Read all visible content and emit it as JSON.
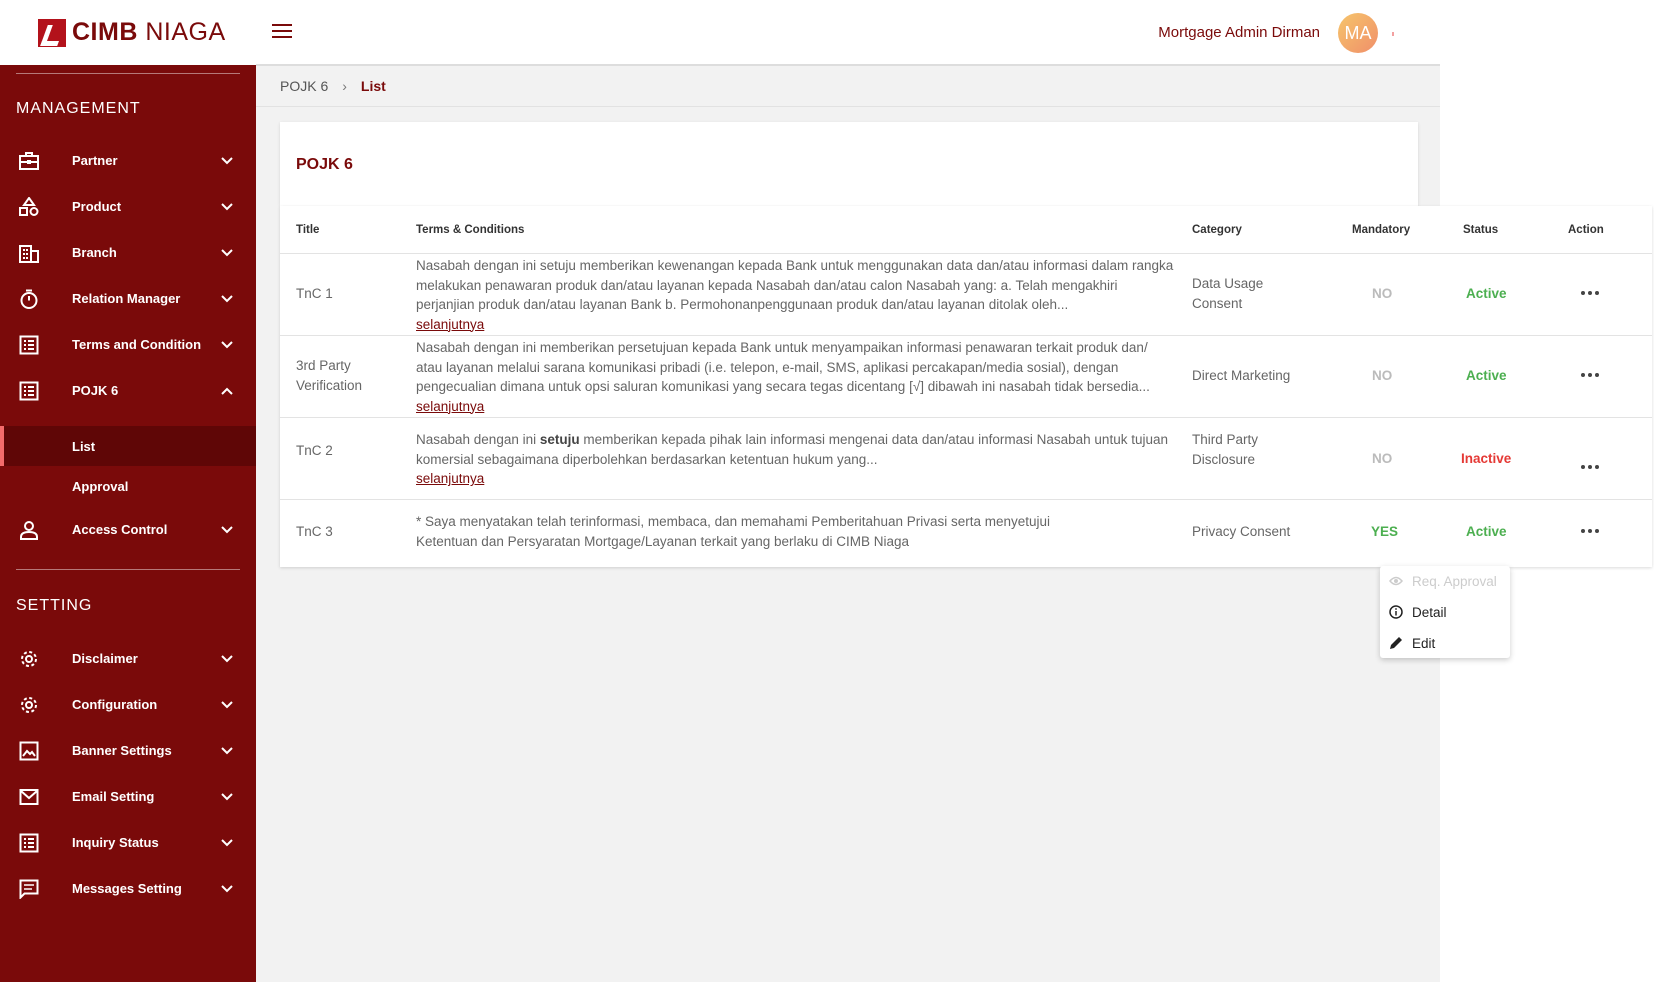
{
  "brand": {
    "name_bold": "CIMB",
    "name_rest": "NIAGA"
  },
  "header": {
    "username": "Mortgage Admin Dirman",
    "avatar_initials": "MA"
  },
  "sidebar": {
    "management_title": "MANAGEMENT",
    "setting_title": "SETTING",
    "items": [
      {
        "label": "Partner",
        "icon": "briefcase-icon"
      },
      {
        "label": "Product",
        "icon": "shapes-icon"
      },
      {
        "label": "Branch",
        "icon": "building-icon"
      },
      {
        "label": "Relation Manager",
        "icon": "timer-icon"
      },
      {
        "label": "Terms and Condition",
        "icon": "list-icon"
      },
      {
        "label": "POJK 6",
        "icon": "list-icon",
        "expanded": true
      },
      {
        "label": "Access Control",
        "icon": "person-icon"
      }
    ],
    "pojk_sub": [
      {
        "label": "List",
        "active": true
      },
      {
        "label": "Approval"
      }
    ],
    "settings": [
      {
        "label": "Disclaimer",
        "icon": "gear-icon"
      },
      {
        "label": "Configuration",
        "icon": "gear-icon"
      },
      {
        "label": "Banner Settings",
        "icon": "image-icon"
      },
      {
        "label": "Email Setting",
        "icon": "mail-icon"
      },
      {
        "label": "Inquiry Status",
        "icon": "list-icon"
      },
      {
        "label": "Messages Setting",
        "icon": "message-icon"
      }
    ]
  },
  "breadcrumb": {
    "parent": "POJK 6",
    "current": "List"
  },
  "card": {
    "title": "POJK 6"
  },
  "table": {
    "headers": {
      "title": "Title",
      "terms": "Terms & Conditions",
      "category": "Category",
      "mandatory": "Mandatory",
      "status": "Status",
      "action": "Action"
    },
    "more_label": "selanjutnya",
    "rows": [
      {
        "title": "TnC 1",
        "terms": "Nasabah dengan ini setuju memberikan kewenangan kepada Bank untuk menggunakan data dan/atau informasi dalam rangka melakukan penawaran produk dan/atau layanan kepada Nasabah dan/atau calon Nasabah yang: a. Telah mengakhiri perjanjian produk dan/atau layanan Bank b. Permohonanpenggunaan produk dan/atau layanan ditolak oleh...",
        "category": "Data Usage Consent",
        "mandatory": "NO",
        "status": "Active"
      },
      {
        "title": "3rd Party Verification",
        "terms": "Nasabah dengan ini memberikan persetujuan kepada Bank untuk menyampaikan informasi penawaran terkait produk dan/ atau layanan melalui sarana komunikasi pribadi (i.e. telepon, e-mail, SMS, aplikasi percakapan/media sosial), dengan pengecualian dimana untuk opsi saluran komunikasi yang secara tegas dicentang [√] dibawah ini nasabah tidak bersedia...",
        "category": "Direct Marketing",
        "mandatory": "NO",
        "status": "Active"
      },
      {
        "title": "TnC 2",
        "terms_pre": "Nasabah dengan ini ",
        "terms_bold": "setuju",
        "terms_post": " memberikan kepada pihak lain informasi  mengenai data dan/atau informasi Nasabah untuk tujuan komersial sebagaimana  diperbolehkan berdasarkan ketentuan hukum yang...",
        "category": "Third Party Disclosure",
        "mandatory": "NO",
        "status": "Inactive"
      },
      {
        "title": "TnC 3",
        "terms": "* Saya menyatakan telah terinformasi, membaca, dan memahami Pemberitahuan Privasi serta menyetujui Ketentuan dan Persyaratan Mortgage/Layanan terkait yang berlaku di CIMB Niaga",
        "category": "Privacy Consent",
        "mandatory": "YES",
        "status": "Active"
      }
    ]
  },
  "menu": {
    "req_approval": "Req. Approval",
    "detail": "Detail",
    "edit": "Edit"
  }
}
